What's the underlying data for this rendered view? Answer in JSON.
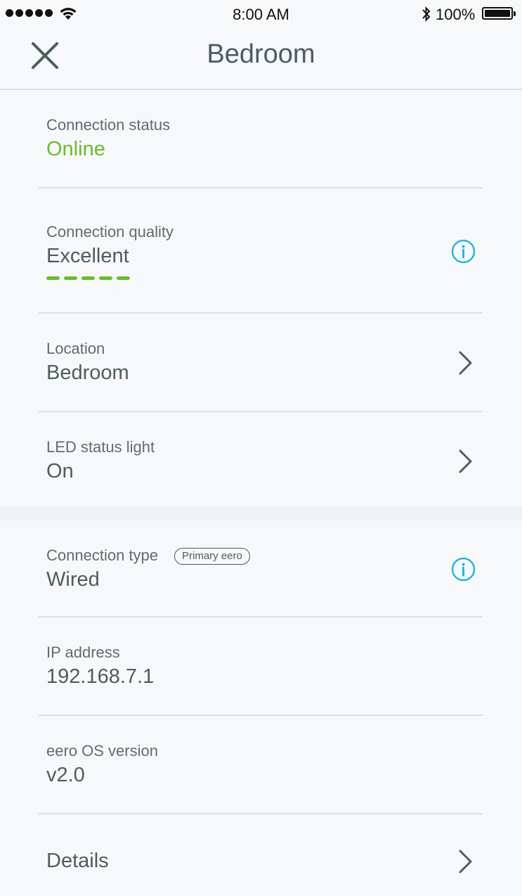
{
  "status_bar": {
    "time": "8:00 AM",
    "battery_percent": "100%",
    "signal_bars": 5,
    "icons": [
      "signal-icon",
      "wifi-icon",
      "bluetooth-icon",
      "battery-icon"
    ]
  },
  "nav": {
    "title": "Bedroom",
    "close_icon": "close-icon"
  },
  "colors": {
    "online": "#68bd2f",
    "quality": "#68bd2f",
    "info": "#29b6d6",
    "text": "#4e5b63"
  },
  "rows": {
    "connection_status": {
      "label": "Connection status",
      "value": "Online"
    },
    "connection_quality": {
      "label": "Connection quality",
      "value": "Excellent",
      "bars": 5
    },
    "location": {
      "label": "Location",
      "value": "Bedroom"
    },
    "led": {
      "label": "LED status light",
      "value": "On"
    },
    "connection_type": {
      "label": "Connection type",
      "badge": "Primary eero",
      "value": "Wired"
    },
    "ip": {
      "label": "IP address",
      "value": "192.168.7.1"
    },
    "os": {
      "label": "eero OS version",
      "value": "v2.0"
    },
    "details": {
      "label": "Details"
    }
  }
}
